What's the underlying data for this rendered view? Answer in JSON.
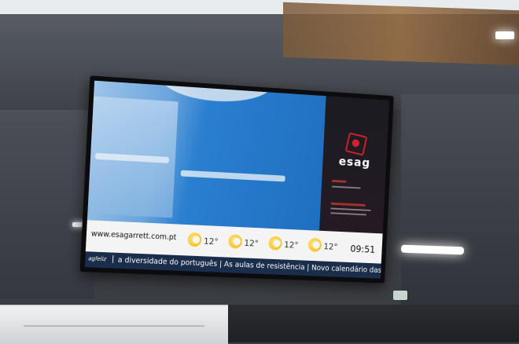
{
  "screen": {
    "sidebar": {
      "logo": "esag"
    },
    "ticker": {
      "url": "www.esagarrett.com.pt",
      "weather": [
        {
          "temp": "12°",
          "icon": "partly-sunny-icon"
        },
        {
          "temp": "12°",
          "icon": "partly-sunny-icon"
        },
        {
          "temp": "12°",
          "icon": "partly-sunny-icon"
        },
        {
          "temp": "12°",
          "icon": "partly-sunny-icon"
        }
      ],
      "time": "09:51"
    },
    "news": {
      "brand": "agfeliz",
      "separator": "|",
      "headline": "a diversidade do português | As aulas de resistência | Novo calendário das matrículas pública"
    }
  },
  "colors": {
    "accent": "#d4212a",
    "news_bar": "#1a2d4a",
    "main_blue": "#1f6fc0"
  }
}
